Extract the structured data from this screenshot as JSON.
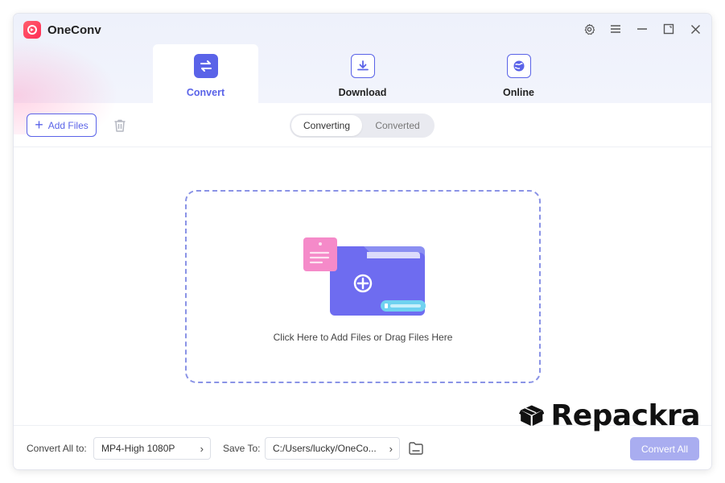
{
  "app": {
    "title": "OneConv"
  },
  "tabs": [
    {
      "label": "Convert",
      "icon": "convert-arrows-icon",
      "active": true
    },
    {
      "label": "Download",
      "icon": "download-icon",
      "active": false
    },
    {
      "label": "Online",
      "icon": "online-globe-icon",
      "active": false
    }
  ],
  "toolbar": {
    "add_files_label": "Add Files",
    "segments": [
      {
        "label": "Converting",
        "active": true
      },
      {
        "label": "Converted",
        "active": false
      }
    ]
  },
  "dropzone": {
    "text": "Click Here to Add Files or Drag Files Here"
  },
  "bottom": {
    "convert_all_to_label": "Convert All to:",
    "format_value": "MP4-High 1080P",
    "save_to_label": "Save To:",
    "save_path": "C:/Users/lucky/OneCo...",
    "convert_all_label": "Convert All"
  },
  "watermark": {
    "text": "Repackra"
  },
  "colors": {
    "accent": "#5a63e8",
    "accent_disabled": "#a9adf0",
    "logo": "#ff2d55"
  }
}
